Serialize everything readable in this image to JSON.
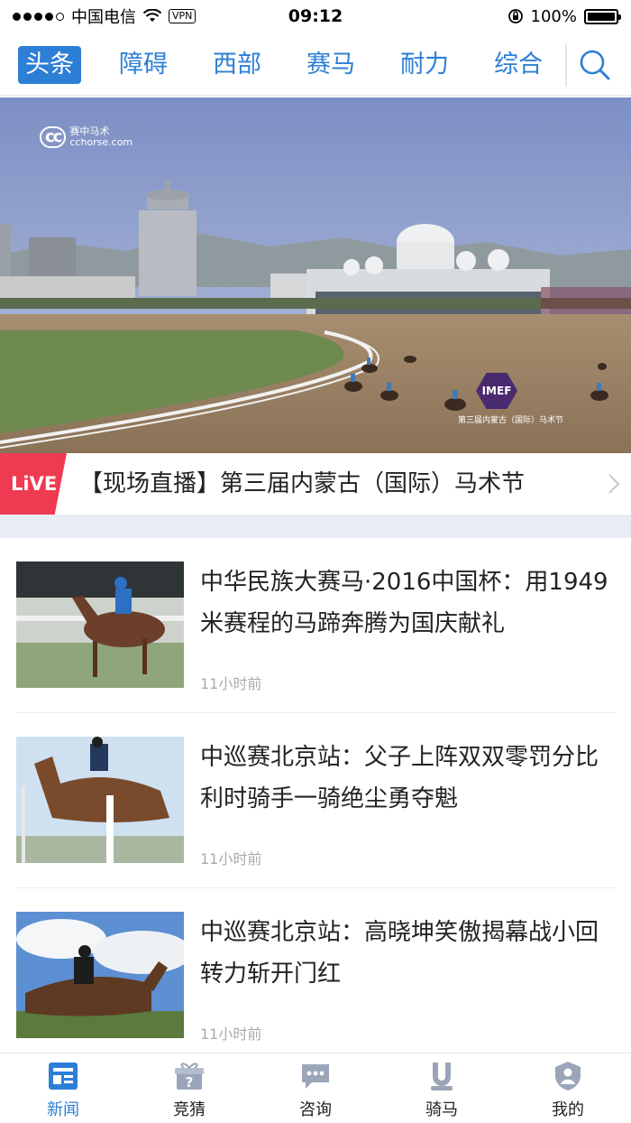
{
  "status_bar": {
    "carrier": "中国电信",
    "vpn": "VPN",
    "time": "09:12",
    "battery": "100%"
  },
  "top_nav": {
    "tabs": [
      {
        "label": "头条",
        "active": true
      },
      {
        "label": "障碍",
        "active": false
      },
      {
        "label": "西部",
        "active": false
      },
      {
        "label": "赛马",
        "active": false
      },
      {
        "label": "耐力",
        "active": false
      },
      {
        "label": "综合",
        "active": false
      }
    ],
    "search_icon": "search-icon"
  },
  "hero": {
    "logo_text": "cc",
    "logo_caption": "赛中马术",
    "logo_domain": "cchorse.com",
    "badge_text": "IMEF",
    "badge_caption": "第三届内蒙古（国际）马术节"
  },
  "live": {
    "badge": "LiVE",
    "title": "【现场直播】第三届内蒙古（国际）马术节"
  },
  "news": [
    {
      "title": "中华民族大赛马·2016中国杯：用1949米赛程的马蹄奔腾为国庆献礼",
      "time": "11小时前"
    },
    {
      "title": "中巡赛北京站：父子上阵双双零罚分比利时骑手一骑绝尘勇夺魁",
      "time": "11小时前"
    },
    {
      "title": "中巡赛北京站：高晓坤笑傲揭幕战小回转力斩开门红",
      "time": "11小时前"
    }
  ],
  "tab_bar": [
    {
      "label": "新闻",
      "icon": "news-icon",
      "active": true
    },
    {
      "label": "竞猜",
      "icon": "gift-icon",
      "active": false
    },
    {
      "label": "咨询",
      "icon": "chat-icon",
      "active": false
    },
    {
      "label": "骑马",
      "icon": "horseshoe-icon",
      "active": false
    },
    {
      "label": "我的",
      "icon": "profile-shield-icon",
      "active": false
    }
  ],
  "colors": {
    "accent": "#2d7fd6",
    "live_red": "#ee3b52",
    "tab_inactive": "#9aa6b8"
  }
}
